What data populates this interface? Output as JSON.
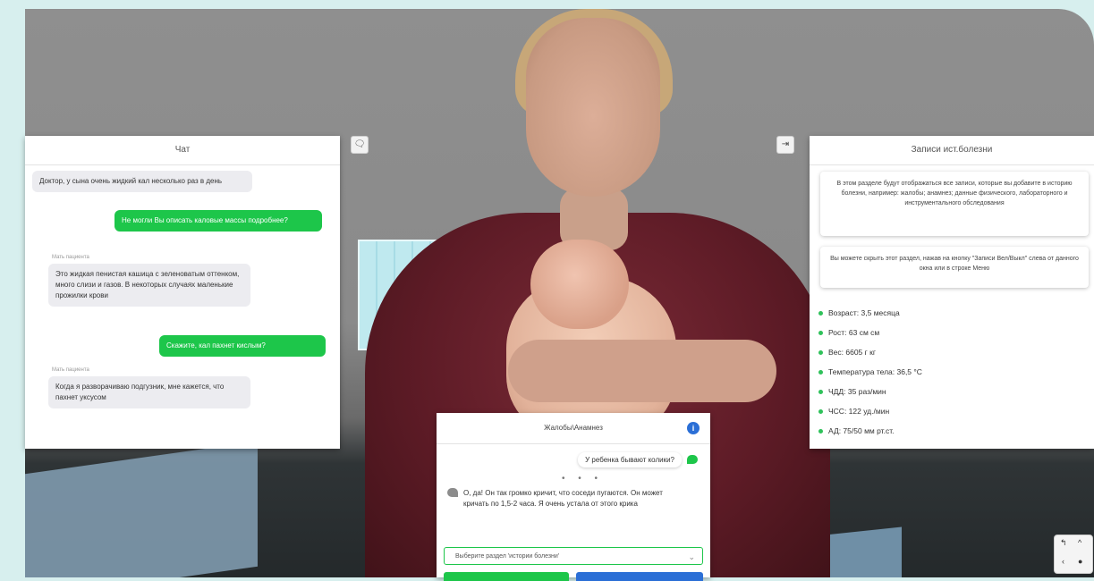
{
  "chat": {
    "title": "Чат",
    "messages": [
      {
        "from": "patient",
        "sender": "",
        "text": "Доктор, у сына очень жидкий кал несколько раз в день"
      },
      {
        "from": "doctor",
        "text": "Не могли Вы описать каловые массы подробнее?"
      },
      {
        "from": "patient",
        "sender": "Мать пациента",
        "text": "Это жидкая пенистая кашица с зеленоватым оттенком, много слизи и газов. В некоторых случаях маленькие прожилки крови"
      },
      {
        "from": "doctor",
        "text": "Скажите, кал пахнет кислым?"
      },
      {
        "from": "patient",
        "sender": "Мать пациента",
        "text": "Когда я разворачиваю подгузник, мне кажется, что пахнет уксусом"
      }
    ]
  },
  "history": {
    "title": "Записи ист.болезни",
    "info_text": "В этом разделе будут отображаться все записи, которые вы добавите в историю болезни, например: жалобы; анамнез; данные физического, лабораторного и инструментального обследования",
    "hide_text": "Вы можете скрыть этот раздел, нажав на кнопку \"Записи Вел/Выкл\" слева от данного окна или в строке Меню",
    "items": [
      "Возраст: 3,5 месяца",
      "Рост: 63 см см",
      "Вес: 6605 г кг",
      "Температура тела: 36,5 °C",
      "ЧДД: 35 раз/мин",
      "ЧСС: 122 уд./мин",
      "АД: 75/50 мм рт.ст."
    ]
  },
  "complaints": {
    "title": "Жалобы\\Анамнез",
    "info": "i",
    "question": "У ребенка бывают колики?",
    "dots": "• • •",
    "answer": "О, да! Он так громко кричит, что соседи пугаются. Он может кричать по 1,5-2 часа. Я очень устала от этого крика",
    "select_placeholder": "Выберите раздел 'истории болезни'",
    "chevron": "⌄"
  },
  "icons": {
    "chat_toggle": "chat-bubble-icon",
    "history_toggle": "exit-icon"
  },
  "nav": {
    "undo": "↰",
    "up": "^",
    "left": "‹",
    "center": "●"
  },
  "colors": {
    "green": "#1dc64a",
    "blue": "#2b6fd6"
  }
}
